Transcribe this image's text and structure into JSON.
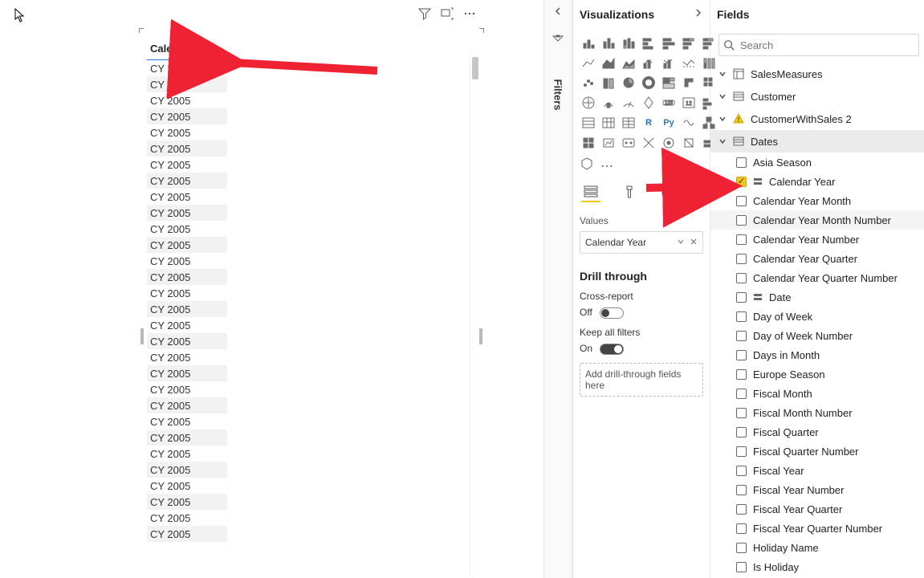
{
  "canvas": {
    "column_header": "Calendar Year",
    "rows": [
      "CY 2005",
      "CY 2005",
      "CY 2005",
      "CY 2005",
      "CY 2005",
      "CY 2005",
      "CY 2005",
      "CY 2005",
      "CY 2005",
      "CY 2005",
      "CY 2005",
      "CY 2005",
      "CY 2005",
      "CY 2005",
      "CY 2005",
      "CY 2005",
      "CY 2005",
      "CY 2005",
      "CY 2005",
      "CY 2005",
      "CY 2005",
      "CY 2005",
      "CY 2005",
      "CY 2005",
      "CY 2005",
      "CY 2005",
      "CY 2005",
      "CY 2005",
      "CY 2005",
      "CY 2005"
    ]
  },
  "filters_label": "Filters",
  "viz": {
    "title": "Visualizations",
    "values_label": "Values",
    "value_chip": "Calendar Year",
    "drill_title": "Drill through",
    "cross_report_label": "Cross-report",
    "cross_report_state": "Off",
    "keep_filters_label": "Keep all filters",
    "keep_filters_state": "On",
    "drop_text": "Add drill-through fields here",
    "py_label": "Py",
    "r_label": "R",
    "ellipsis": "⋯"
  },
  "fields": {
    "title": "Fields",
    "search_placeholder": "Search",
    "tables": [
      {
        "name": "SalesMeasures",
        "icon": "calc",
        "expanded": false
      },
      {
        "name": "Customer",
        "icon": "table",
        "expanded": false
      },
      {
        "name": "CustomerWithSales 2",
        "icon": "warning",
        "expanded": false
      },
      {
        "name": "Dates",
        "icon": "table",
        "expanded": true
      }
    ],
    "date_fields": [
      {
        "label": "Asia Season",
        "checked": false
      },
      {
        "label": "Calendar Year",
        "checked": true,
        "hierarchy": true
      },
      {
        "label": "Calendar Year Month",
        "checked": false
      },
      {
        "label": "Calendar Year Month Number",
        "checked": false,
        "highlight": true
      },
      {
        "label": "Calendar Year Number",
        "checked": false
      },
      {
        "label": "Calendar Year Quarter",
        "checked": false
      },
      {
        "label": "Calendar Year Quarter Number",
        "checked": false
      },
      {
        "label": "Date",
        "checked": false,
        "hierarchy": true
      },
      {
        "label": "Day of Week",
        "checked": false
      },
      {
        "label": "Day of Week Number",
        "checked": false
      },
      {
        "label": "Days in Month",
        "checked": false
      },
      {
        "label": "Europe Season",
        "checked": false
      },
      {
        "label": "Fiscal Month",
        "checked": false
      },
      {
        "label": "Fiscal Month Number",
        "checked": false
      },
      {
        "label": "Fiscal Quarter",
        "checked": false
      },
      {
        "label": "Fiscal Quarter Number",
        "checked": false
      },
      {
        "label": "Fiscal Year",
        "checked": false
      },
      {
        "label": "Fiscal Year Number",
        "checked": false
      },
      {
        "label": "Fiscal Year Quarter",
        "checked": false
      },
      {
        "label": "Fiscal Year Quarter Number",
        "checked": false
      },
      {
        "label": "Holiday Name",
        "checked": false
      },
      {
        "label": "Is Holiday",
        "checked": false
      }
    ]
  }
}
